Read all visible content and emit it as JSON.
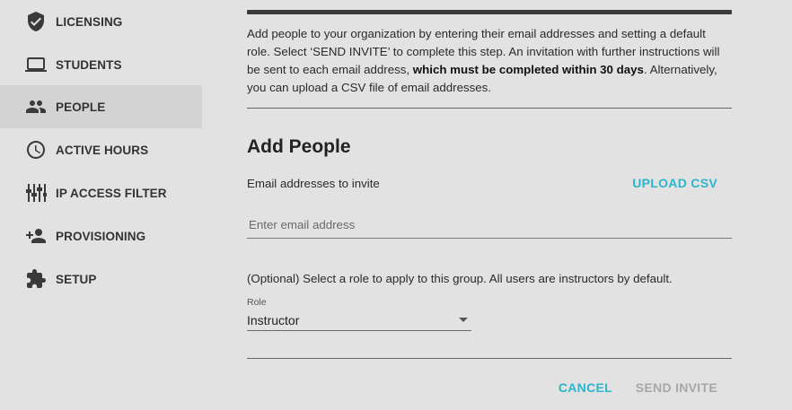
{
  "sidebar": {
    "items": [
      {
        "label": "LICENSING",
        "icon": "shield-check-icon"
      },
      {
        "label": "STUDENTS",
        "icon": "laptop-icon"
      },
      {
        "label": "PEOPLE",
        "icon": "people-icon",
        "active": true
      },
      {
        "label": "ACTIVE HOURS",
        "icon": "clock-icon"
      },
      {
        "label": "IP ACCESS FILTER",
        "icon": "sliders-icon"
      },
      {
        "label": "PROVISIONING",
        "icon": "person-add-icon"
      },
      {
        "label": "SETUP",
        "icon": "puzzle-icon"
      }
    ]
  },
  "main": {
    "intro": {
      "part1": "Add people to your organization by entering their email addresses and setting a default role. Select ‘SEND INVITE’ to complete this step. An invitation with further instructions will be sent to each email address, ",
      "bold": "which must be completed within 30 days",
      "part2": ". Alternatively, you can upload a CSV file of email addresses."
    },
    "title": "Add People",
    "email_label": "Email addresses to invite",
    "upload_label": "UPLOAD CSV",
    "email_placeholder": "Enter email address",
    "role_hint": "(Optional) Select a role to apply to this group. All users are instructors by default.",
    "role_label": "Role",
    "role_value": "Instructor",
    "cancel_label": "CANCEL",
    "send_label": "SEND INVITE"
  },
  "colors": {
    "accent": "#2db5cc",
    "disabled": "#a7a7a7",
    "background": "#e2e2e2",
    "active_item": "#d3d3d3"
  }
}
